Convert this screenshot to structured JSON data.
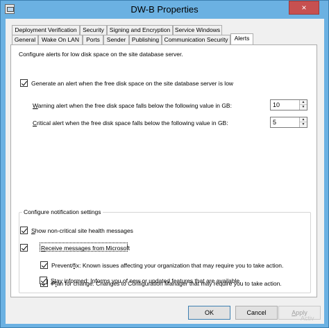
{
  "window": {
    "title": "DW-B Properties",
    "close_glyph": "×"
  },
  "tabs_row1": [
    {
      "label": "Deployment Verification"
    },
    {
      "label": "Security"
    },
    {
      "label": "Signing and Encryption"
    },
    {
      "label": "Service Windows"
    }
  ],
  "tabs_row2": [
    {
      "label": "General"
    },
    {
      "label": "Wake On LAN"
    },
    {
      "label": "Ports"
    },
    {
      "label": "Sender"
    },
    {
      "label": "Publishing"
    },
    {
      "label": "Communication Security"
    },
    {
      "label": "Alerts",
      "active": true
    }
  ],
  "alerts": {
    "intro": "Configure alerts for low disk space on the site database server.",
    "generate_alert_label": "Generate an alert when the free disk space on the site database server is low",
    "generate_alert_checked": true,
    "warning_label_first": "W",
    "warning_label_rest": "arning alert when the free disk space falls below the following value in GB:",
    "warning_value": "10",
    "critical_label_first": "C",
    "critical_label_rest": "ritical alert when the free disk space falls below the following value in GB:",
    "critical_value": "5"
  },
  "notifications": {
    "group_label": "Configure notification settings",
    "show_noncritical_first": "S",
    "show_noncritical_rest": "how non-critical site health messages",
    "show_noncritical_checked": true,
    "receive_ms_first": "R",
    "receive_ms_rest": "eceive messages from Microsoft",
    "receive_ms_checked": true,
    "prevent_fix_pre": "Prevent/",
    "prevent_fix_key": "f",
    "prevent_fix_rest": "ix: Known issues affecting your organization that may require you to take action.",
    "prevent_fix_checked": true,
    "plan_change_pre": "P",
    "plan_change_key": "l",
    "plan_change_rest": "an for change: Changes to Configuration Manager that may require you to take action.",
    "plan_change_checked": true,
    "stay_informed_pre": "",
    "stay_informed_key": "S",
    "stay_informed_rest": "tay informed: Informs you of new or updated features that are available.",
    "stay_informed_checked": true
  },
  "buttons": {
    "ok": "OK",
    "cancel": "Cancel",
    "apply_first": "A",
    "apply_rest": "pply"
  },
  "watermark": "Activ"
}
